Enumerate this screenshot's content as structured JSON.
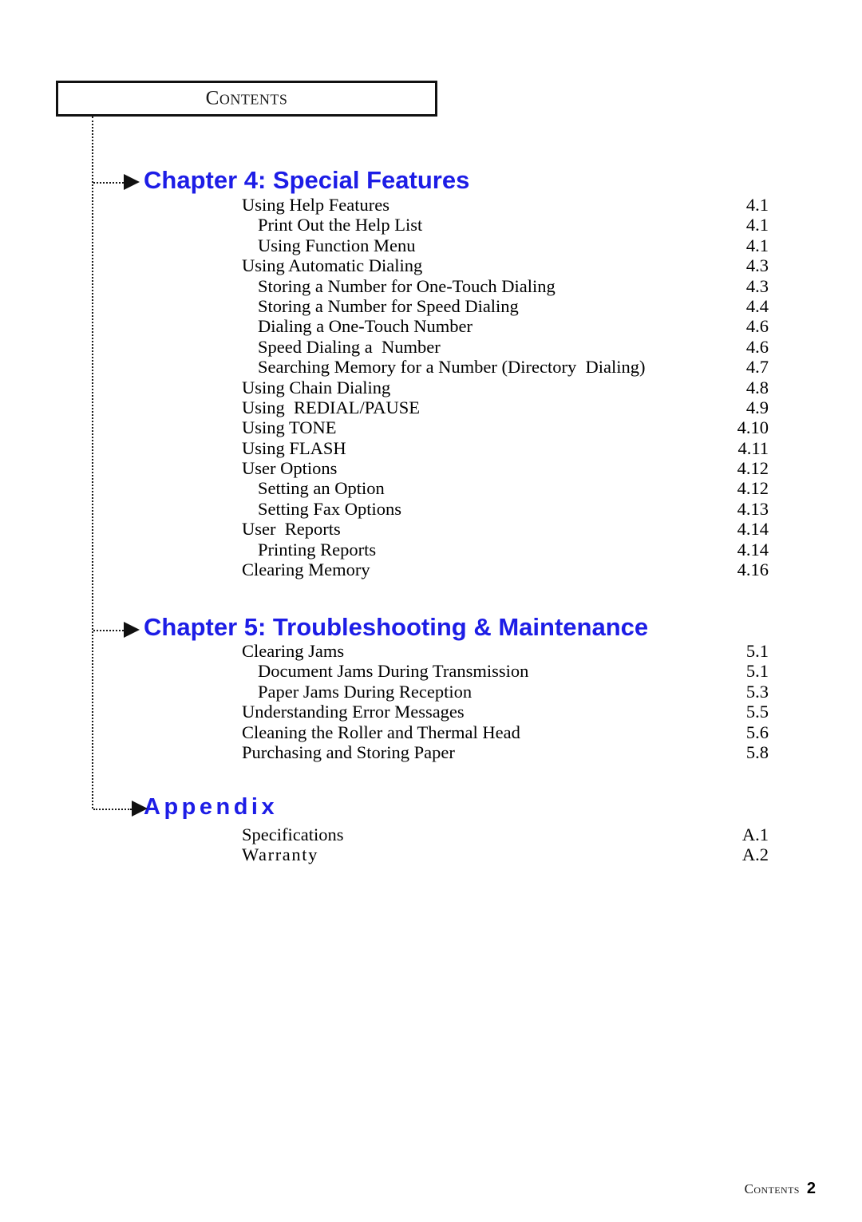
{
  "header": {
    "running_head": "Contents"
  },
  "footer": {
    "label": "Contents",
    "page_number": "2"
  },
  "colors": {
    "heading_blue": "#1d1de6",
    "text_black": "#000000",
    "rule_black": "#111111"
  },
  "sections": [
    {
      "heading": "Chapter  4:   Special  Features",
      "kind": "chapter",
      "entries": [
        {
          "title": "Using Help Features",
          "page": "4.1",
          "level": 0
        },
        {
          "title": "Print Out the Help List",
          "page": "4.1",
          "level": 1
        },
        {
          "title": "Using Function Menu",
          "page": "4.1",
          "level": 1
        },
        {
          "title": "Using Automatic Dialing",
          "page": "4.3",
          "level": 0
        },
        {
          "title": "Storing a Number for One-Touch Dialing",
          "page": "4.3",
          "level": 1
        },
        {
          "title": "Storing a Number for Speed Dialing",
          "page": "4.4",
          "level": 1
        },
        {
          "title": "Dialing a One-Touch Number",
          "page": "4.6",
          "level": 1
        },
        {
          "title": "Speed Dialing a  Number",
          "page": "4.6",
          "level": 1
        },
        {
          "title": "Searching Memory for a Number (Directory  Dialing)",
          "page": "4.7",
          "level": 1
        },
        {
          "title": "Using Chain Dialing",
          "page": "4.8",
          "level": 0
        },
        {
          "title": "Using  REDIAL/PAUSE",
          "page": "4.9",
          "level": 0
        },
        {
          "title": "Using TONE",
          "page": "4.10",
          "level": 0
        },
        {
          "title": "Using FLASH",
          "page": "4.11",
          "level": 0
        },
        {
          "title": "User Options",
          "page": "4.12",
          "level": 0
        },
        {
          "title": "Setting an Option",
          "page": "4.12",
          "level": 1
        },
        {
          "title": "Setting Fax Options",
          "page": "4.13",
          "level": 1
        },
        {
          "title": "User  Reports",
          "page": "4.14",
          "level": 0
        },
        {
          "title": "Printing Reports",
          "page": "4.14",
          "level": 1
        },
        {
          "title": "Clearing Memory",
          "page": "4.16",
          "level": 0
        }
      ]
    },
    {
      "heading": "Chapter 5:   Troubleshooting  &  Maintenance",
      "kind": "chapter",
      "entries": [
        {
          "title": "Clearing Jams",
          "page": "5.1",
          "level": 0
        },
        {
          "title": "Document Jams During Transmission",
          "page": "5.1",
          "level": 1
        },
        {
          "title": "Paper Jams During Reception",
          "page": "5.3",
          "level": 1
        },
        {
          "title": "Understanding Error Messages",
          "page": "5.5",
          "level": 0
        },
        {
          "title": "Cleaning the Roller and Thermal Head",
          "page": "5.6",
          "level": 0
        },
        {
          "title": "Purchasing and Storing Paper",
          "page": "5.8",
          "level": 0
        }
      ]
    },
    {
      "heading": "Appendix",
      "kind": "appendix",
      "entries": [
        {
          "title": "Specifications",
          "page": "A.1",
          "level": 0
        },
        {
          "title": "Warranty",
          "page": "A.2",
          "level": 0,
          "tracked": true
        }
      ]
    }
  ]
}
